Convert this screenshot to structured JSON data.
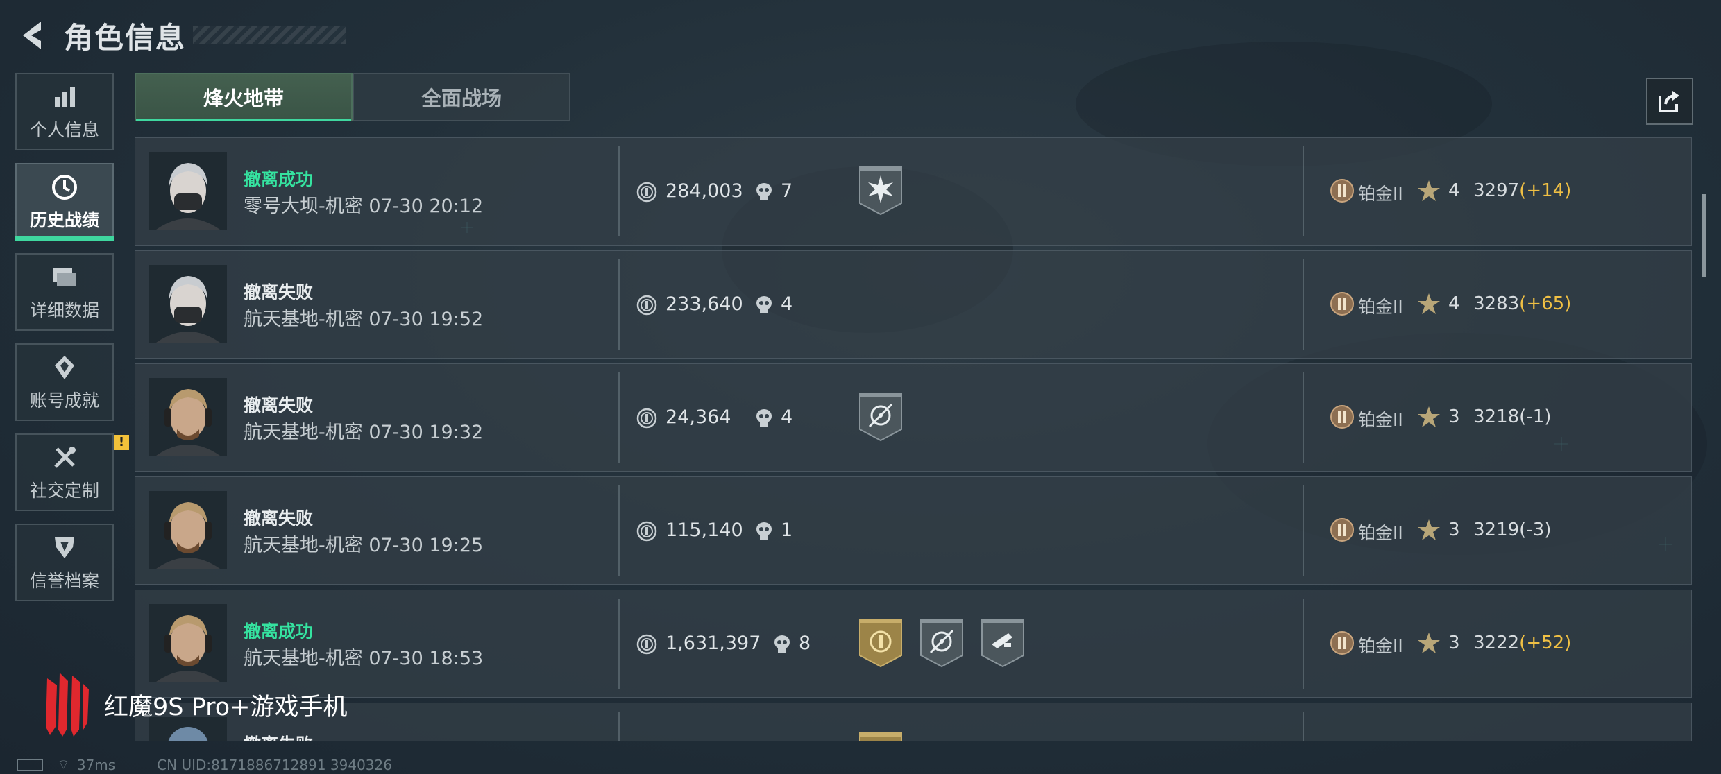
{
  "header": {
    "title": "角色信息",
    "back_icon": "back-arrow-icon"
  },
  "sidebar": {
    "items": [
      {
        "label": "个人信息",
        "icon": "bar-chart-icon",
        "active": false
      },
      {
        "label": "历史战绩",
        "icon": "clock-icon",
        "active": true
      },
      {
        "label": "详细数据",
        "icon": "folder-icon",
        "active": false
      },
      {
        "label": "账号成就",
        "icon": "medal-icon",
        "active": false
      },
      {
        "label": "社交定制",
        "icon": "tools-icon",
        "active": false,
        "notification": "!"
      },
      {
        "label": "信誉档案",
        "icon": "shield-icon",
        "active": false
      }
    ]
  },
  "tabs": [
    {
      "label": "烽火地带",
      "active": true
    },
    {
      "label": "全面战场",
      "active": false
    }
  ],
  "share_icon": "share-icon",
  "matches": [
    {
      "status": "撤离成功",
      "success": true,
      "map": "零号大坝-机密 07-30 20:12",
      "value": "284,003",
      "kills": "7",
      "badges": [
        "star-burst-badge"
      ],
      "rank": "铂金II",
      "stars": "4",
      "score": "3297",
      "delta": "(+14)",
      "avatar": "female-operator"
    },
    {
      "status": "撤离失败",
      "success": false,
      "map": "航天基地-机密 07-30 19:52",
      "value": "233,640",
      "kills": "4",
      "badges": [],
      "rank": "铂金II",
      "stars": "4",
      "score": "3283",
      "delta": "(+65)",
      "avatar": "female-operator"
    },
    {
      "status": "撤离失败",
      "success": false,
      "map": "航天基地-机密 07-30 19:32",
      "value": "24,364",
      "kills": "4",
      "badges": [
        "crosshair-badge"
      ],
      "rank": "铂金II",
      "stars": "3",
      "score": "3218",
      "delta": "(-1)",
      "avatar": "male-operator"
    },
    {
      "status": "撤离失败",
      "success": false,
      "map": "航天基地-机密 07-30 19:25",
      "value": "115,140",
      "kills": "1",
      "badges": [],
      "rank": "铂金II",
      "stars": "3",
      "score": "3219",
      "delta": "(-3)",
      "avatar": "male-operator"
    },
    {
      "status": "撤离成功",
      "success": true,
      "map": "航天基地-机密 07-30 18:53",
      "value": "1,631,397",
      "kills": "8",
      "badges": [
        "gold-coin-badge",
        "crosshair-badge",
        "weapon-badge"
      ],
      "rank": "铂金II",
      "stars": "3",
      "score": "3222",
      "delta": "(+52)",
      "avatar": "male-operator"
    },
    {
      "status": "撤离失败",
      "success": false,
      "map": "",
      "value": "",
      "kills": "",
      "badges": [
        "gold-coin-badge"
      ],
      "rank": "",
      "stars": "",
      "score": "",
      "delta": "",
      "avatar": "helmet-operator"
    }
  ],
  "footer": {
    "brand": "红魔9S Pro+游戏手机",
    "ping": "37ms",
    "uid": "CN UID:8171886712891 3940326"
  },
  "colors": {
    "accent": "#3fd79f",
    "success": "#35e3a0",
    "delta_positive": "#f0c044",
    "notification": "#f2c13a"
  }
}
